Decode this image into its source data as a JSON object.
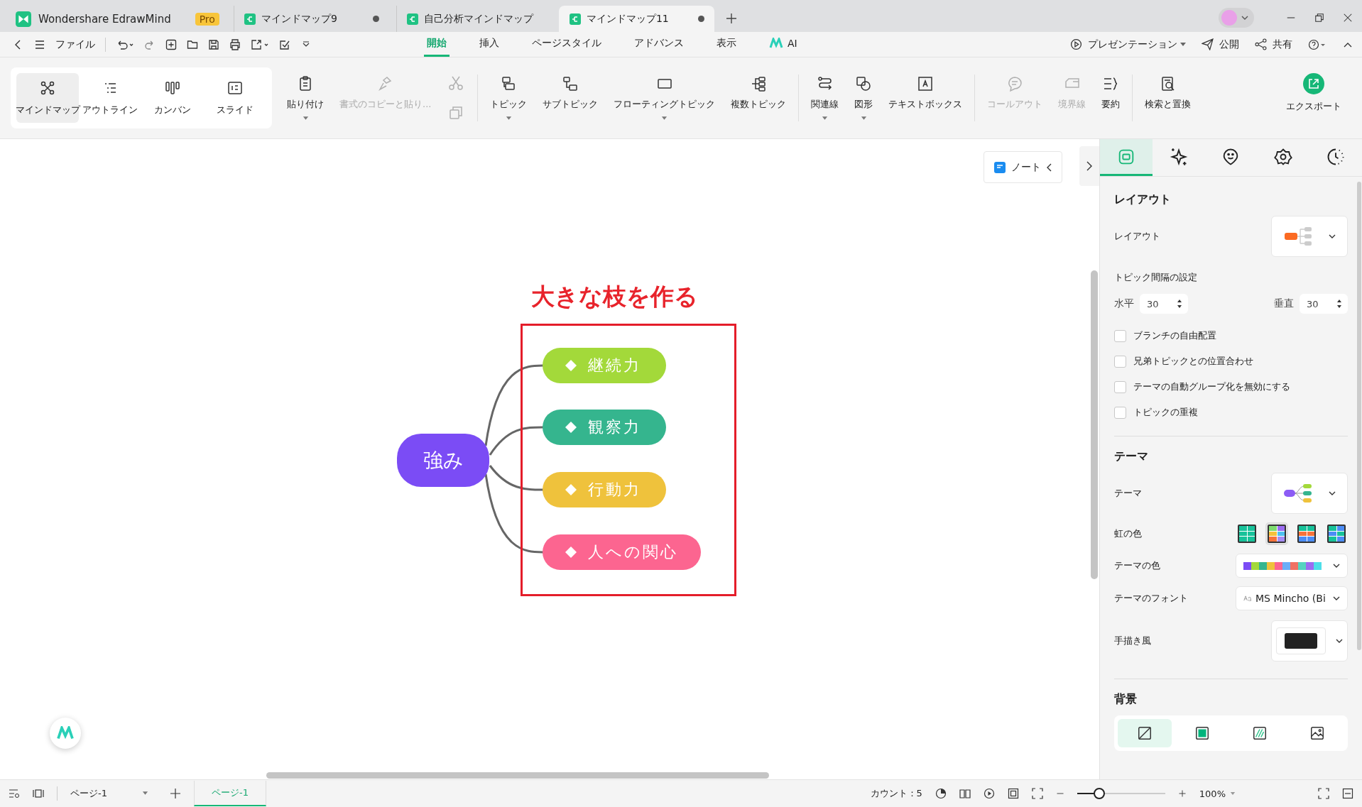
{
  "app_tab": {
    "title": "Wondershare EdrawMind",
    "badge": "Pro"
  },
  "doc_tabs": [
    {
      "title": "マインドマップ9",
      "selected": false,
      "modified": true
    },
    {
      "title": "自己分析マインドマップ",
      "selected": false,
      "modified": false
    },
    {
      "title": "マインドマップ11",
      "selected": true,
      "modified": true
    }
  ],
  "menu": {
    "file": "ファイル"
  },
  "ribbon_tabs": [
    {
      "label": "開始",
      "selected": true
    },
    {
      "label": "挿入",
      "selected": false
    },
    {
      "label": "ページスタイル",
      "selected": false
    },
    {
      "label": "アドバンス",
      "selected": false
    },
    {
      "label": "表示",
      "selected": false
    },
    {
      "label": "AI",
      "selected": false
    }
  ],
  "menu_right": {
    "present": "プレゼンテーション",
    "publish": "公開",
    "share": "共有"
  },
  "view_modes": [
    {
      "label": "マインドマップ",
      "selected": true
    },
    {
      "label": "アウトライン",
      "selected": false
    },
    {
      "label": "カンバン",
      "selected": false
    },
    {
      "label": "スライド",
      "selected": false
    }
  ],
  "tool_groups": [
    [
      {
        "label": "貼り付け",
        "disabled": false,
        "dropdown": true
      },
      {
        "label": "書式のコピーと貼り...",
        "disabled": true,
        "dropdown": false
      }
    ],
    [
      {
        "label": "トピック",
        "disabled": false,
        "dropdown": true
      },
      {
        "label": "サブトピック",
        "disabled": false,
        "dropdown": false
      },
      {
        "label": "フローティングトピック",
        "disabled": false,
        "dropdown": true
      },
      {
        "label": "複数トピック",
        "disabled": false,
        "dropdown": false
      }
    ],
    [
      {
        "label": "関連線",
        "disabled": false,
        "dropdown": true
      },
      {
        "label": "図形",
        "disabled": false,
        "dropdown": true
      },
      {
        "label": "テキストボックス",
        "disabled": false,
        "dropdown": false
      }
    ],
    [
      {
        "label": "コールアウト",
        "disabled": true,
        "dropdown": false
      },
      {
        "label": "境界線",
        "disabled": true,
        "dropdown": false
      },
      {
        "label": "要約",
        "disabled": false,
        "dropdown": false
      }
    ],
    [
      {
        "label": "検索と置換",
        "disabled": false,
        "dropdown": false
      }
    ]
  ],
  "export": {
    "label": "エクスポート"
  },
  "note_button": {
    "label": "ノート"
  },
  "canvas": {
    "title": "大きな枝を作る",
    "central_topic": "強み",
    "branches": [
      {
        "label": "継続力",
        "color": "#a3d93a"
      },
      {
        "label": "観察力",
        "color": "#35b58e"
      },
      {
        "label": "行動力",
        "color": "#efc23c"
      },
      {
        "label": "人への関心",
        "color": "#fc6590"
      }
    ]
  },
  "panel": {
    "tabs": [
      {
        "selected": true
      },
      {
        "selected": false
      },
      {
        "selected": false
      },
      {
        "selected": false
      },
      {
        "selected": false
      }
    ],
    "layout_heading": "レイアウト",
    "layout_label": "レイアウト",
    "spacing_label": "トピック間隔の設定",
    "horizontal": {
      "label": "水平",
      "value": "30"
    },
    "vertical": {
      "label": "垂直",
      "value": "30"
    },
    "checkboxes": [
      {
        "label": "ブランチの自由配置",
        "checked": false
      },
      {
        "label": "兄弟トピックとの位置合わせ",
        "checked": false
      },
      {
        "label": "テーマの自動グループ化を無効にする",
        "checked": false
      },
      {
        "label": "トピックの重複",
        "checked": false
      }
    ],
    "theme_heading": "テーマ",
    "theme_label": "テーマ",
    "rainbow_label": "虹の色",
    "rainbow_options": [
      {
        "selected": false
      },
      {
        "selected": true
      },
      {
        "selected": false
      },
      {
        "selected": false
      }
    ],
    "theme_color_label": "テーマの色",
    "theme_font_label": "テーマのフォント",
    "theme_font": "MS Mincho (Bi",
    "hand_drawn_label": "手描き風",
    "background_heading": "背景",
    "background_options": [
      {
        "selected": true
      },
      {
        "selected": false
      },
      {
        "selected": false
      },
      {
        "selected": false
      }
    ]
  },
  "status_bar": {
    "page_select": "ページ-1",
    "page_tab": "ページ-1",
    "count": "カウント：5",
    "zoom": "100%",
    "zoom_slider": {
      "level": 0.25
    }
  }
}
